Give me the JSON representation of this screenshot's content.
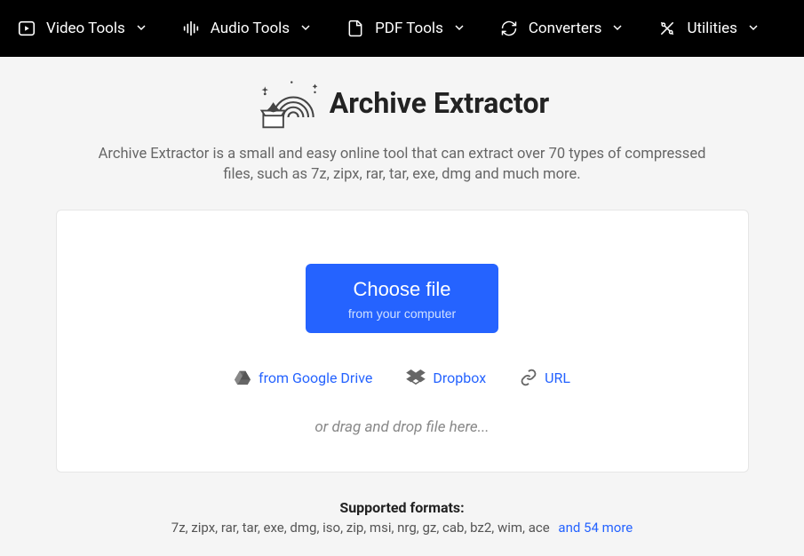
{
  "nav": {
    "items": [
      {
        "label": "Video Tools"
      },
      {
        "label": "Audio Tools"
      },
      {
        "label": "PDF Tools"
      },
      {
        "label": "Converters"
      },
      {
        "label": "Utilities"
      }
    ]
  },
  "hero": {
    "title": "Archive Extractor",
    "description": "Archive Extractor is a small and easy online tool that can extract over 70 types of compressed files, such as 7z, zipx, rar, tar, exe, dmg and much more."
  },
  "uploader": {
    "choose_label": "Choose file",
    "choose_sub": "from your computer",
    "alt_sources": [
      {
        "label": "from Google Drive"
      },
      {
        "label": "Dropbox"
      },
      {
        "label": "URL"
      }
    ],
    "drop_hint": "or drag and drop file here..."
  },
  "formats": {
    "title": "Supported formats:",
    "list": "7z, zipx, rar, tar, exe, dmg, iso, zip, msi, nrg, gz, cab, bz2, wim, ace",
    "more": "and 54 more"
  }
}
